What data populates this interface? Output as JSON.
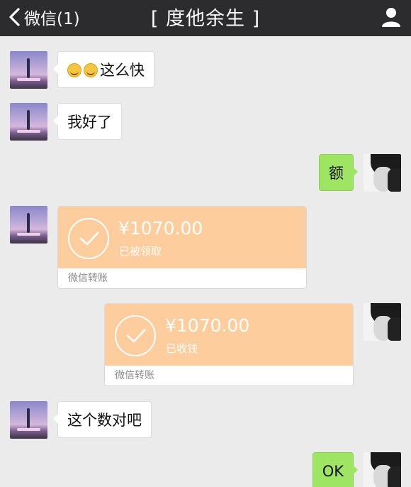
{
  "header": {
    "back_label": "微信(1)",
    "title": "[ 度他余生 ]"
  },
  "messages": {
    "m1": {
      "sender": "other",
      "text": "这么快",
      "emoji_count": 2
    },
    "m2": {
      "sender": "other",
      "text": "我好了"
    },
    "m3": {
      "sender": "me",
      "text": "额"
    },
    "m4": {
      "sender": "other",
      "type": "transfer",
      "amount": "¥1070.00",
      "status": "已被领取",
      "footer": "微信转账"
    },
    "m5": {
      "sender": "me",
      "type": "transfer",
      "amount": "¥1070.00",
      "status": "已收钱",
      "footer": "微信转账"
    },
    "m6": {
      "sender": "other",
      "text": "这个数对吧"
    },
    "m7": {
      "sender": "me",
      "text": "OK"
    }
  },
  "colors": {
    "topbar": "#2c2c2e",
    "background": "#ebebeb",
    "my_bubble": "#9fe564",
    "transfer": "#fecd9d"
  }
}
